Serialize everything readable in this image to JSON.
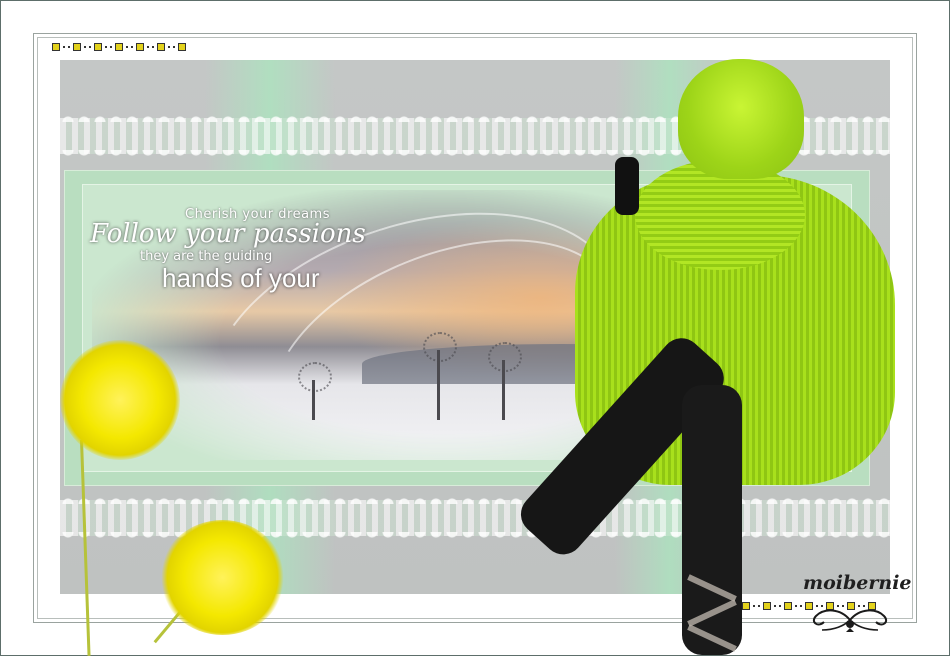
{
  "poem": {
    "line1": "Cherish your dreams",
    "line2": "Follow your passions",
    "line3": "they are the guiding",
    "line4": "hands of your"
  },
  "signature": {
    "text": "moibernie"
  },
  "colors": {
    "frame_border": "#5d6e6a",
    "canvas_gray": "#c2c5c4",
    "mint": "#b9dec0",
    "lime": "#a8e01c",
    "flower_yellow": "#f4e800",
    "dot_yellow": "#e3d21c"
  },
  "icons": {
    "corner_dots": "square-dot-border-icon",
    "ornament": "scroll-flourish-icon"
  }
}
